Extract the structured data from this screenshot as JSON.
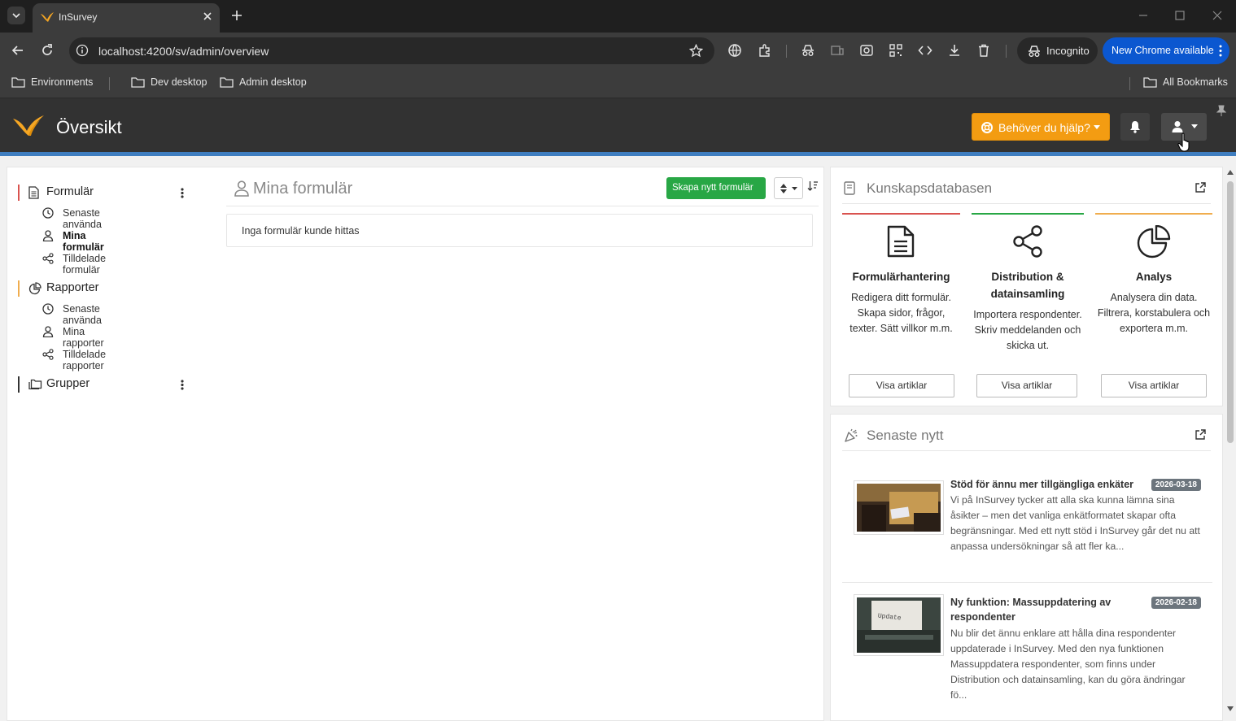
{
  "browser": {
    "tab_title": "InSurvey",
    "url": "localhost:4200/sv/admin/overview",
    "incognito_label": "Incognito",
    "update_label": "New Chrome available",
    "bookmarks": [
      "Environments",
      "Dev desktop",
      "Admin desktop"
    ],
    "all_bookmarks_label": "All Bookmarks"
  },
  "header": {
    "title": "Översikt",
    "help_label": "Behöver du hjälp?"
  },
  "sidebar": {
    "forms": {
      "label": "Formulär",
      "items": [
        {
          "label": "Senaste använda",
          "icon": "clock-icon"
        },
        {
          "label": "Mina formulär",
          "icon": "user-icon",
          "active": true
        },
        {
          "label": "Tilldelade formulär",
          "icon": "share-icon"
        }
      ]
    },
    "reports": {
      "label": "Rapporter",
      "items": [
        {
          "label": "Senaste använda",
          "icon": "clock-icon"
        },
        {
          "label": "Mina rapporter",
          "icon": "user-icon"
        },
        {
          "label": "Tilldelade rapporter",
          "icon": "share-icon"
        }
      ]
    },
    "groups": {
      "label": "Grupper"
    }
  },
  "main": {
    "title": "Mina formulär",
    "create_label": "Skapa nytt formulär",
    "empty_text": "Inga formulär kunde hittas"
  },
  "knowledge": {
    "title": "Kunskapsdatabasen",
    "columns": [
      {
        "title": "Formulärhantering",
        "desc": "Redigera ditt formulär. Skapa sidor, frågor, texter. Sätt villkor m.m.",
        "button": "Visa artiklar",
        "color": "#d9534f"
      },
      {
        "title": "Distribution & datainsamling",
        "desc": "Importera respondenter. Skriv meddelanden och skicka ut.",
        "button": "Visa artiklar",
        "color": "#28a745"
      },
      {
        "title": "Analys",
        "desc": "Analysera din data. Filtrera, korstabulera och exportera m.m.",
        "button": "Visa artiklar",
        "color": "#f0ad4e"
      }
    ]
  },
  "news": {
    "title": "Senaste nytt",
    "items": [
      {
        "title": "Stöd för ännu mer tillgängliga enkäter",
        "date": "2026-03-18",
        "text": "Vi på InSurvey tycker att alla ska kunna lämna sina åsikter – men det vanliga enkätformatet skapar ofta begränsningar. Med ett nytt stöd i InSurvey går det nu att anpassa undersökningar så att fler ka..."
      },
      {
        "title": "Ny funktion: Massuppdatering av respondenter",
        "date": "2026-02-18",
        "text": "Nu blir det ännu enklare att hålla dina respondenter uppdaterade i InSurvey. Med den nya funktionen Massuppdatera respondenter, som finns under Distribution och datainsamling, kan du göra ändringar fö..."
      }
    ]
  },
  "colors": {
    "header_bg": "#323232",
    "header_accent": "#3f7ec0",
    "help_orange": "#f39c12",
    "create_green": "#28a745",
    "forms_marker": "#d9534f",
    "reports_marker": "#f0ad4e",
    "groups_marker": "#333333",
    "chrome_blue": "#0b57d0"
  }
}
